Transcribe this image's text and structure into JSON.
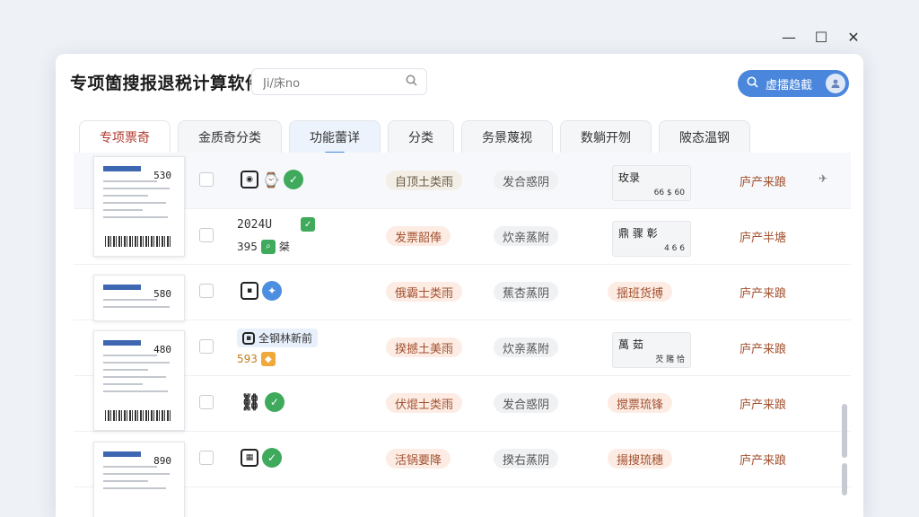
{
  "window_controls": {
    "minimize": "—",
    "maximize": "☐",
    "close": "✕"
  },
  "titlebar": {
    "title": "专项箇搜报退税计算软件功能",
    "search_value": "Ji/床no",
    "user_button_label": "虚擂趋截"
  },
  "tabs": [
    "专项票奇",
    "金质奇分类",
    "功能蕾详",
    "分类",
    "务景蔑视",
    "数躺开刎",
    "陂态温钢"
  ],
  "rows": [
    {
      "thumb_number": "530",
      "status1": "自顶土类雨",
      "status2": "发合惑阴",
      "mini_text": "玫录",
      "mini_sub": "66 $ 60",
      "source": "庐产来踉",
      "send": "✈"
    },
    {
      "text_line1": "2024U",
      "text_line2": "395",
      "text_line2b": "桀",
      "status1": "发票韶俸",
      "status2": "炊亲蒸附",
      "mini_text": "鼎 骤 彰",
      "mini_sub": "4 6 6",
      "source": "庐产半塘"
    },
    {
      "thumb_number": "580",
      "status1": "俄霸士类雨",
      "status2": "蕉杏蒸阴",
      "status3": "揺班货搏",
      "source": "庐产来踉"
    },
    {
      "thumb_number": "480",
      "text_line1": "全钢林新前",
      "text_line2": "593",
      "status1": "揆撼土美雨",
      "status2": "炊亲蒸附",
      "mini_text": "萬 茹",
      "mini_sub": "芡 賭 恰",
      "source": "庐产来踉"
    },
    {
      "status1": "伏焜士类雨",
      "status2": "发合惑阴",
      "status3": "搅票琉锋",
      "source": "庐产来踉"
    },
    {
      "thumb_number": "890",
      "status1": "活锅要降",
      "status2": "揆右蒸阴",
      "status3": "揚搜琉穗",
      "source": "庐产来踉"
    }
  ]
}
